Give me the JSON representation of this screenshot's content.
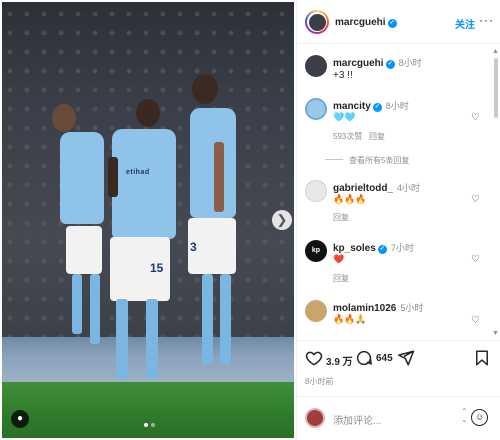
{
  "photo": {
    "jersey_numbers": [
      "15",
      "3"
    ],
    "sponsor": "etihad",
    "colors": {
      "kit": "#8fc3ea",
      "pitch": "#2f7a2c",
      "shorts": "#f2f2f2"
    },
    "carousel": {
      "count": 2,
      "active_index": 0
    },
    "icons": {
      "next": "chevron-right-icon",
      "tag": "user-tag-icon"
    }
  },
  "header": {
    "username": "marcguehi",
    "follow_label": "关注",
    "more_label": "···"
  },
  "caption": {
    "username": "marcguehi",
    "time": "8小时",
    "text": "+3 !!"
  },
  "comments": [
    {
      "username": "mancity",
      "verified": true,
      "time": "8小时",
      "text": "🩵🩵",
      "likes": "593次赞",
      "reply_label": "回复",
      "view_replies": "查看所有5条回复"
    },
    {
      "username": "gabrieltodd_",
      "verified": false,
      "time": "4小时",
      "text": "🔥🔥🔥",
      "reply_label": "回复"
    },
    {
      "username": "kp_soles",
      "verified": true,
      "time": "7小时",
      "text": "❤️",
      "reply_label": "回复"
    },
    {
      "username": "molamin1026",
      "verified": false,
      "time": "5小时",
      "text": "🔥🔥🙏"
    }
  ],
  "actions": {
    "likes": "3.9 万",
    "comments": "645",
    "posted": "8小时前"
  },
  "composer": {
    "placeholder": "添加评论...",
    "emoji_icon": "smiley-icon"
  },
  "accent_color": "#0095f6"
}
